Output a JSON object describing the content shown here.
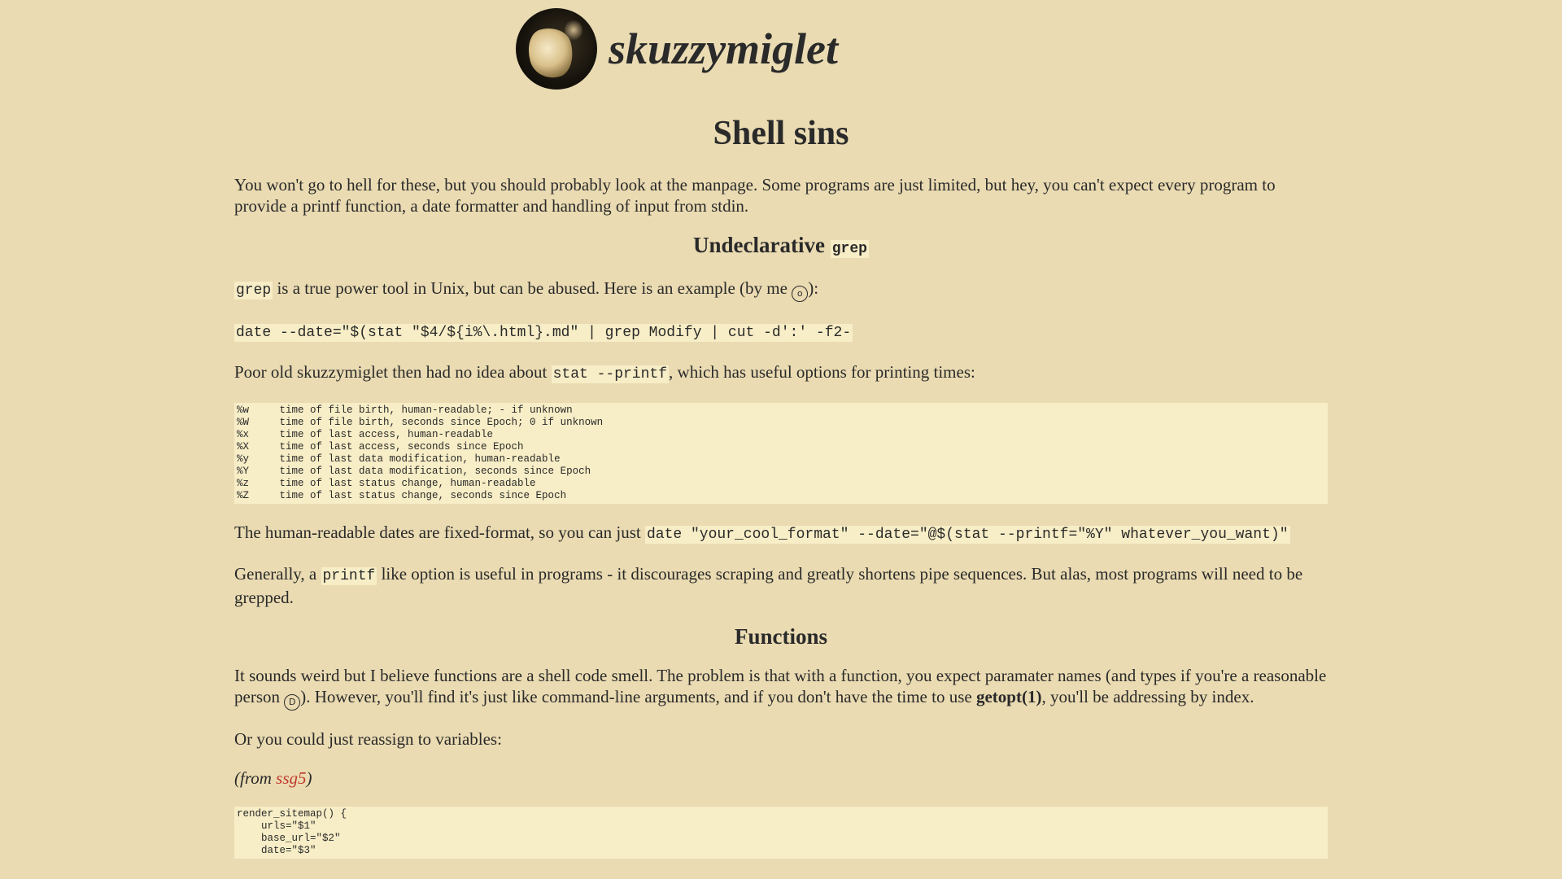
{
  "site": {
    "name": "skuzzymiglet"
  },
  "title": "Shell sins",
  "intro": "You won't go to hell for these, but you should probably look at the manpage. Some programs are just limited, but hey, you can't expect every program to provide a printf function, a date formatter and handling of input from stdin.",
  "section1": {
    "heading_text": "Undeclarative",
    "heading_code": "grep",
    "p1_code": "grep",
    "p1_text": " is a true power tool in Unix, but can be abused. Here is an example (by me ",
    "p1_end": "):",
    "cmd": "date --date=\"$(stat \"$4/${i%\\.html}.md\" | grep Modify | cut -d':' -f2-",
    "p2_a": "Poor old skuzzymiglet then had no idea about ",
    "p2_code": "stat --printf",
    "p2_b": ", which has useful options for printing times:",
    "pre": "%w     time of file birth, human-readable; - if unknown\n%W     time of file birth, seconds since Epoch; 0 if unknown\n%x     time of last access, human-readable\n%X     time of last access, seconds since Epoch\n%y     time of last data modification, human-readable\n%Y     time of last data modification, seconds since Epoch\n%z     time of last status change, human-readable\n%Z     time of last status change, seconds since Epoch",
    "p3_a": "The human-readable dates are fixed-format, so you can just ",
    "p3_code": "date \"your_cool_format\" --date=\"@$(stat --printf=\"%Y\" whatever_you_want)\"",
    "p4_a": "Generally, a ",
    "p4_code": "printf",
    "p4_b": " like option is useful in programs - it discourages scraping and greatly shortens pipe sequences. But alas, most programs will need to be grepped."
  },
  "section2": {
    "heading": "Functions",
    "p1_a": "It sounds weird but I believe functions are a shell code smell. The problem is that with a function, you expect paramater names (and types if you're a reasonable person ",
    "p1_b": "). However, you'll find it's just like command-line arguments, and if you don't have the time to use ",
    "p1_bold": "getopt(1)",
    "p1_c": ", you'll be addressing by index.",
    "p2": "Or you could just reassign to variables:",
    "from_a": "(from ",
    "from_link": "ssg5",
    "from_b": ")",
    "pre": "render_sitemap() {\n    urls=\"$1\"\n    base_url=\"$2\"\n    date=\"$3\""
  },
  "emojis": {
    "surprised": "o",
    "grin": "D"
  }
}
